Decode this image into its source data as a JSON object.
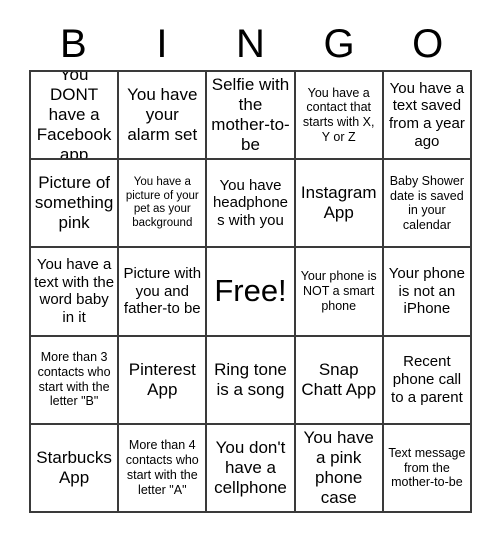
{
  "card": {
    "title_letters": [
      "B",
      "I",
      "N",
      "G",
      "O"
    ],
    "grid_size": 5,
    "free_space_index": 12,
    "colors": {
      "background": "#ffffff",
      "border": "#3a3a3a",
      "text": "#000000"
    },
    "cells": [
      {
        "text": "You DONT have a Facebook app",
        "size": "lg"
      },
      {
        "text": "You have your alarm set",
        "size": "lg"
      },
      {
        "text": "Selfie with the mother-to-be",
        "size": "lg"
      },
      {
        "text": "You have a contact that starts with X, Y or Z",
        "size": "sm"
      },
      {
        "text": "You have a text saved from a year ago",
        "size": "md"
      },
      {
        "text": "Picture of something pink",
        "size": "lg"
      },
      {
        "text": "You have a picture of your pet as your background",
        "size": "xs"
      },
      {
        "text": "You have headphones with you",
        "size": "md"
      },
      {
        "text": "Instagram App",
        "size": "lg"
      },
      {
        "text": "Baby Shower date is saved in your calendar",
        "size": "sm"
      },
      {
        "text": "You have a text with the word baby in it",
        "size": "md"
      },
      {
        "text": "Picture with you and father-to be",
        "size": "md"
      },
      {
        "text": "Free!",
        "size": "xl"
      },
      {
        "text": "Your phone is NOT a smart phone",
        "size": "sm"
      },
      {
        "text": "Your phone is not an iPhone",
        "size": "md"
      },
      {
        "text": "More than 3 contacts who start with the letter \"B\"",
        "size": "sm"
      },
      {
        "text": "Pinterest App",
        "size": "lg"
      },
      {
        "text": "Ring tone is a song",
        "size": "lg"
      },
      {
        "text": "Snap Chatt App",
        "size": "lg"
      },
      {
        "text": "Recent phone call to a parent",
        "size": "md"
      },
      {
        "text": "Starbucks App",
        "size": "lg"
      },
      {
        "text": "More than 4 contacts who start with the letter \"A\"",
        "size": "sm"
      },
      {
        "text": "You don't have a cellphone",
        "size": "lg"
      },
      {
        "text": "You have a pink phone case",
        "size": "lg"
      },
      {
        "text": "Text message from the mother-to-be",
        "size": "sm"
      }
    ]
  }
}
